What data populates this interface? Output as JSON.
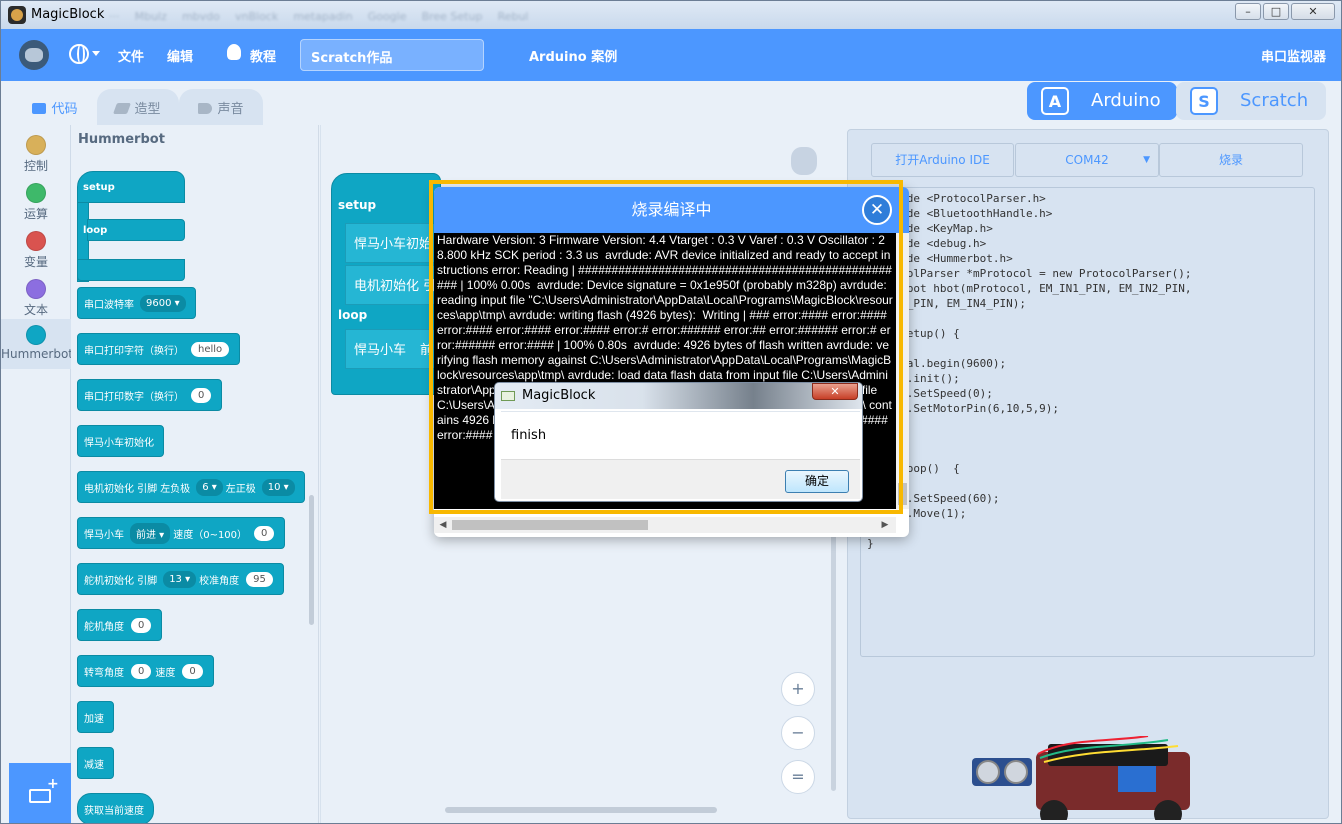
{
  "window": {
    "title": "MagicBlock",
    "blurred_tabs": [
      "···",
      "Mbulz",
      "mbvdo",
      "vnBlock",
      "metapadin",
      "Google",
      "Bree Setup",
      "Rebul"
    ],
    "minimize": "–",
    "maximize": "□",
    "close": "✕"
  },
  "menu": {
    "file": "文件",
    "edit": "编辑",
    "tutorial": "教程",
    "project_title": "Scratch作品",
    "arduino_examples": "Arduino 案例",
    "serial_monitor": "串口监视器"
  },
  "tabs": {
    "code": "代码",
    "costume": "造型",
    "sound": "声音"
  },
  "modes": {
    "arduino": "Arduino",
    "scratch": "Scratch"
  },
  "categories": [
    {
      "label": "控制",
      "color": "#d8b05a"
    },
    {
      "label": "运算",
      "color": "#3eb96a"
    },
    {
      "label": "变量",
      "color": "#d9534f"
    },
    {
      "label": "文本",
      "color": "#8c6ee0"
    },
    {
      "label": "Hummerbot",
      "color": "#0fa6c4"
    }
  ],
  "palette": {
    "title": "Hummerbot",
    "hat_setup": "setup",
    "hat_loop": "loop",
    "baud_label": "串口波特率",
    "baud_value": "9600",
    "print_str_label": "串口打印字符（换行）",
    "print_str_value": "hello",
    "print_num_label": "串口打印数字（换行）",
    "print_num_value": "0",
    "car_init": "悍马小车初始化",
    "motor_init_label": "电机初始化 引脚",
    "motor_left_label": "左负极",
    "motor_left_value": "6",
    "motor_right_label": "左正极",
    "motor_right_value": "10",
    "car_label": "悍马小车",
    "car_dir": "前进",
    "car_speed_label": "速度（0~100）",
    "car_speed_value": "0",
    "servo_init_label": "舵机初始化 引脚",
    "servo_pin": "13",
    "servo_cal_label": "校准角度",
    "servo_cal_value": "95",
    "servo_angle_label": "舵机角度",
    "servo_angle_value": "0",
    "turn_label": "转弯角度",
    "turn_value": "0",
    "turn_speed_label": "速度",
    "turn_speed_value": "0",
    "accelerate": "加速",
    "decelerate": "减速",
    "get_speed": "获取当前速度"
  },
  "workspace": {
    "setup_label": "setup",
    "block_car_init": "悍马小车初始",
    "block_motor_init": "电机初始化 引",
    "loop_label": "loop",
    "block_car": "悍马小车",
    "block_car_dir": "前",
    "zoom_in": "+",
    "zoom_out": "−",
    "zoom_reset": "="
  },
  "codepanel": {
    "open_ide": "打开Arduino IDE",
    "port": "COM42",
    "upload": "烧录",
    "code": "#include <ProtocolParser.h>\n#include <BluetoothHandle.h>\n#include <KeyMap.h>\n#include <debug.h>\n#include <Hummerbot.h>\nProtocolParser *mProtocol = new ProtocolParser();\nHummerbot hbot(mProtocol, EM_IN1_PIN, EM_IN2_PIN,\nEM_IN3_PIN, EM_IN4_PIN);\n\nvoid setup() {\n\n  Serial.begin(9600);\n  hbot.init();\n  hbot.SetSpeed(0);\n  hbot.SetMotorPin(6,10,5,9);\n}\n\n\nvoid loop()  {\n\n  hbot.SetSpeed(60);\n  hbot.Move(1);\n\n}"
  },
  "modal": {
    "title": "烧录编译中",
    "close": "✕",
    "log": "Hardware Version: 3 Firmware Version: 4.4 Vtarget : 0.3 V Varef : 0.3 V Oscillator : 28.800 kHz SCK period : 3.3 us  avrdude: AVR device initialized and ready to accept instructions error: Reading | ################################################## | 100% 0.00s  avrdude: Device signature = 0x1e950f (probably m328p) avrdude: reading input file \"C:\\Users\\Administrator\\AppData\\Local\\Programs\\MagicBlock\\resources\\app\\tmp\\ avrdude: writing flash (4926 bytes):  Writing | ### error:#### error:#### error:#### error:#### error:#### error:# error:###### error:## error:###### error:# error:###### error:#### | 100% 0.80s  avrdude: 4926 bytes of flash written avrdude: verifying flash memory against C:\\Users\\Administrator\\AppData\\Local\\Programs\\MagicBlock\\resources\\app\\tmp\\ avrdude: load data flash data from input file C:\\Users\\Administrator\\AppData\\Local\\Programs\\MagicBlock\\resources\\app\\tmp\\ avrdude: input file C:\\Users\\Administrator\\AppData\\Local\\Programs\\MagicBlock\\resources\\app\\tmp\\ contains 4926 bytes avrdude: reading on-chip flash data: Reading | error:#### error:#### error:#### error:#### error:#### | 100% 0.62s"
  },
  "alert": {
    "title": "MagicBlock",
    "close": "✕",
    "message": "finish",
    "ok": "确定"
  }
}
